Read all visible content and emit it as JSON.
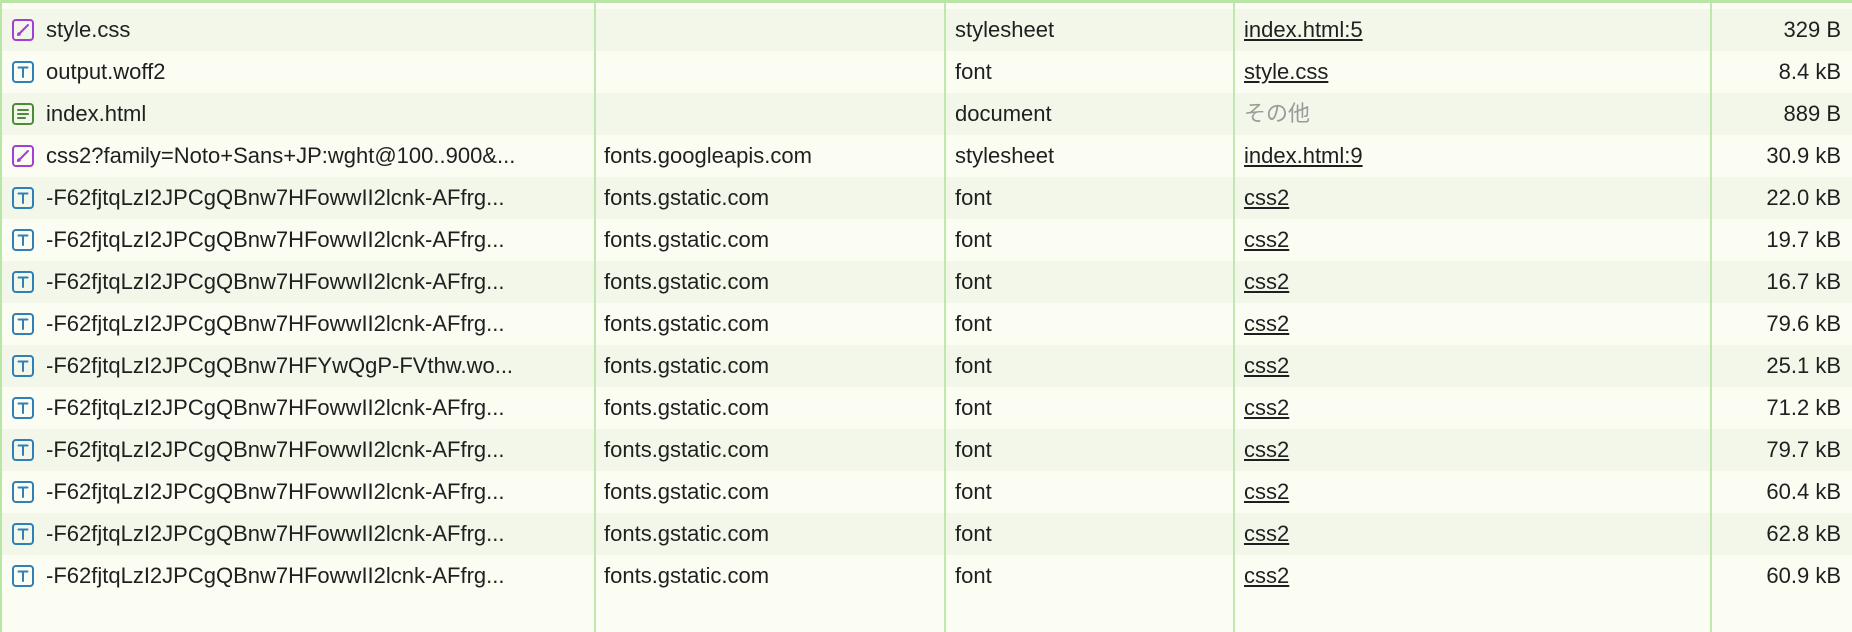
{
  "colors": {
    "stylesheet_icon": "#a23fd6",
    "font_icon": "#2f7fb8",
    "document_icon": "#4f8a3a",
    "divider": "#bfe8ad",
    "row_alt": "#f3f7ea",
    "row_base": "#fbfdf3"
  },
  "requests": [
    {
      "name": "style.css",
      "domain": "",
      "type": "stylesheet",
      "initiator": "index.html:5",
      "initiator_link": true,
      "size": "329 B",
      "icon": "stylesheet-icon"
    },
    {
      "name": "output.woff2",
      "domain": "",
      "type": "font",
      "initiator": "style.css",
      "initiator_link": true,
      "size": "8.4 kB",
      "icon": "font-icon"
    },
    {
      "name": "index.html",
      "domain": "",
      "type": "document",
      "initiator": "その他",
      "initiator_link": false,
      "size": "889 B",
      "icon": "document-icon"
    },
    {
      "name": "css2?family=Noto+Sans+JP:wght@100..900&...",
      "domain": "fonts.googleapis.com",
      "type": "stylesheet",
      "initiator": "index.html:9",
      "initiator_link": true,
      "size": "30.9 kB",
      "icon": "stylesheet-icon"
    },
    {
      "name": "-F62fjtqLzI2JPCgQBnw7HFowwII2lcnk-AFfrg...",
      "domain": "fonts.gstatic.com",
      "type": "font",
      "initiator": "css2",
      "initiator_link": true,
      "size": "22.0 kB",
      "icon": "font-icon"
    },
    {
      "name": "-F62fjtqLzI2JPCgQBnw7HFowwII2lcnk-AFfrg...",
      "domain": "fonts.gstatic.com",
      "type": "font",
      "initiator": "css2",
      "initiator_link": true,
      "size": "19.7 kB",
      "icon": "font-icon"
    },
    {
      "name": "-F62fjtqLzI2JPCgQBnw7HFowwII2lcnk-AFfrg...",
      "domain": "fonts.gstatic.com",
      "type": "font",
      "initiator": "css2",
      "initiator_link": true,
      "size": "16.7 kB",
      "icon": "font-icon"
    },
    {
      "name": "-F62fjtqLzI2JPCgQBnw7HFowwII2lcnk-AFfrg...",
      "domain": "fonts.gstatic.com",
      "type": "font",
      "initiator": "css2",
      "initiator_link": true,
      "size": "79.6 kB",
      "icon": "font-icon"
    },
    {
      "name": "-F62fjtqLzI2JPCgQBnw7HFYwQgP-FVthw.wo...",
      "domain": "fonts.gstatic.com",
      "type": "font",
      "initiator": "css2",
      "initiator_link": true,
      "size": "25.1 kB",
      "icon": "font-icon"
    },
    {
      "name": "-F62fjtqLzI2JPCgQBnw7HFowwII2lcnk-AFfrg...",
      "domain": "fonts.gstatic.com",
      "type": "font",
      "initiator": "css2",
      "initiator_link": true,
      "size": "71.2 kB",
      "icon": "font-icon"
    },
    {
      "name": "-F62fjtqLzI2JPCgQBnw7HFowwII2lcnk-AFfrg...",
      "domain": "fonts.gstatic.com",
      "type": "font",
      "initiator": "css2",
      "initiator_link": true,
      "size": "79.7 kB",
      "icon": "font-icon"
    },
    {
      "name": "-F62fjtqLzI2JPCgQBnw7HFowwII2lcnk-AFfrg...",
      "domain": "fonts.gstatic.com",
      "type": "font",
      "initiator": "css2",
      "initiator_link": true,
      "size": "60.4 kB",
      "icon": "font-icon"
    },
    {
      "name": "-F62fjtqLzI2JPCgQBnw7HFowwII2lcnk-AFfrg...",
      "domain": "fonts.gstatic.com",
      "type": "font",
      "initiator": "css2",
      "initiator_link": true,
      "size": "62.8 kB",
      "icon": "font-icon"
    },
    {
      "name": "-F62fjtqLzI2JPCgQBnw7HFowwII2lcnk-AFfrg...",
      "domain": "fonts.gstatic.com",
      "type": "font",
      "initiator": "css2",
      "initiator_link": true,
      "size": "60.9 kB",
      "icon": "font-icon"
    }
  ]
}
